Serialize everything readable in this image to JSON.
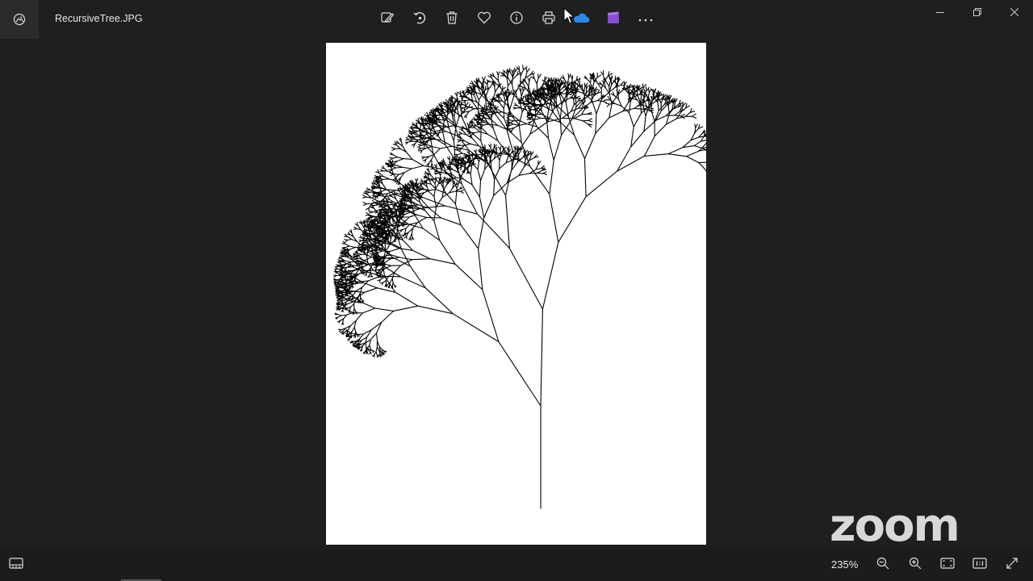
{
  "window": {
    "file_name": "RecursiveTree.JPG",
    "app_icon": "photos-app-icon"
  },
  "toolbar": {
    "items": [
      {
        "name": "edit-image-button",
        "icon": "edit-icon"
      },
      {
        "name": "rotate-button",
        "icon": "rotate-icon"
      },
      {
        "name": "delete-button",
        "icon": "trash-icon"
      },
      {
        "name": "favorite-button",
        "icon": "heart-icon"
      },
      {
        "name": "info-button",
        "icon": "info-icon"
      },
      {
        "name": "print-button",
        "icon": "print-icon"
      },
      {
        "name": "onedrive-button",
        "icon": "cloud-icon"
      },
      {
        "name": "video-editor-button",
        "icon": "clapperboard-icon"
      },
      {
        "name": "more-options-button",
        "icon": "more-icon"
      }
    ],
    "cloud_color": "#2b8ae6",
    "video_color": "#8a4dd6"
  },
  "window_controls": [
    "minimize",
    "restore",
    "close"
  ],
  "watermark": {
    "text": "zoom"
  },
  "bottom_bar": {
    "zoom_level": "235%",
    "buttons": [
      "zoom-out",
      "zoom-in",
      "fit-to-window",
      "actual-size",
      "fullscreen"
    ]
  }
}
